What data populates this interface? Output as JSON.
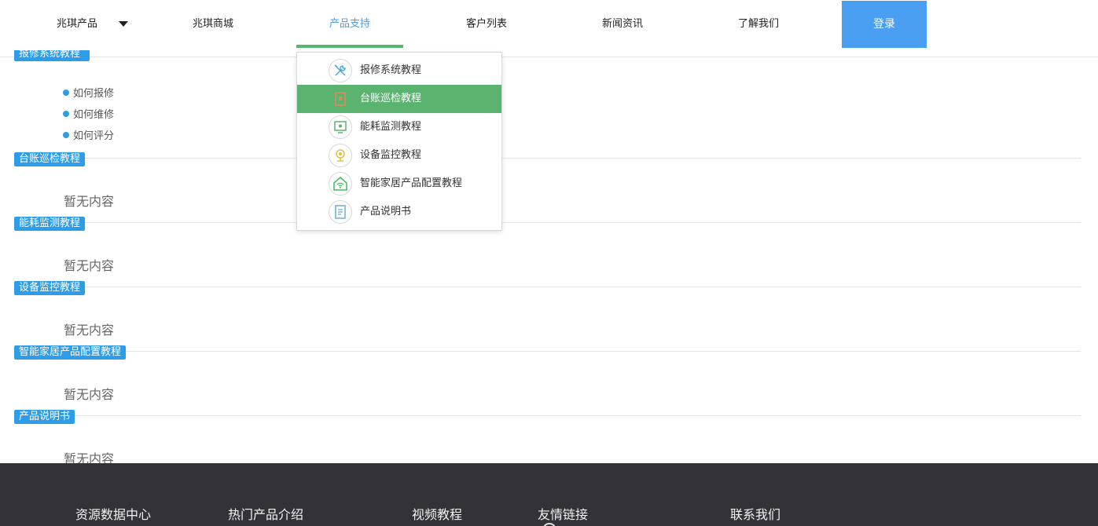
{
  "header": {
    "nav": [
      {
        "label": "兆琪产品"
      },
      {
        "label": "兆琪商城"
      },
      {
        "label": "产品支持"
      },
      {
        "label": "客户列表"
      },
      {
        "label": "新闻资讯"
      },
      {
        "label": "了解我们"
      }
    ],
    "login_label": "登录",
    "accent_color": "#4a9ff2",
    "active_underline_color": "#5bb370"
  },
  "dropdown": {
    "items": [
      {
        "label": "报修系统教程",
        "icon": "wrench-screwdriver-icon"
      },
      {
        "label": "台账巡检教程",
        "icon": "ledger-door-icon"
      },
      {
        "label": "能耗监测教程",
        "icon": "monitor-energy-icon"
      },
      {
        "label": "设备监控教程",
        "icon": "camera-icon"
      },
      {
        "label": "智能家居产品配置教程",
        "icon": "smart-home-icon"
      },
      {
        "label": "产品说明书",
        "icon": "document-icon"
      }
    ],
    "highlight_color": "#5bb370"
  },
  "repair": {
    "links": [
      "如何报修",
      "如何维修",
      "如何评分"
    ]
  },
  "sections": [
    {
      "tag": "台账巡检教程",
      "empty": "暂无内容"
    },
    {
      "tag": "能耗监测教程",
      "empty": "暂无内容"
    },
    {
      "tag": "设备监控教程",
      "empty": "暂无内容"
    },
    {
      "tag": "智能家居产品配置教程",
      "empty": "暂无内容"
    },
    {
      "tag": "产品说明书",
      "empty": "暂无内容"
    }
  ],
  "footer": {
    "columns": [
      "资源数据中心",
      "热门产品介绍",
      "视频教程",
      "友情链接",
      "联系我们"
    ],
    "background": "#323238"
  }
}
